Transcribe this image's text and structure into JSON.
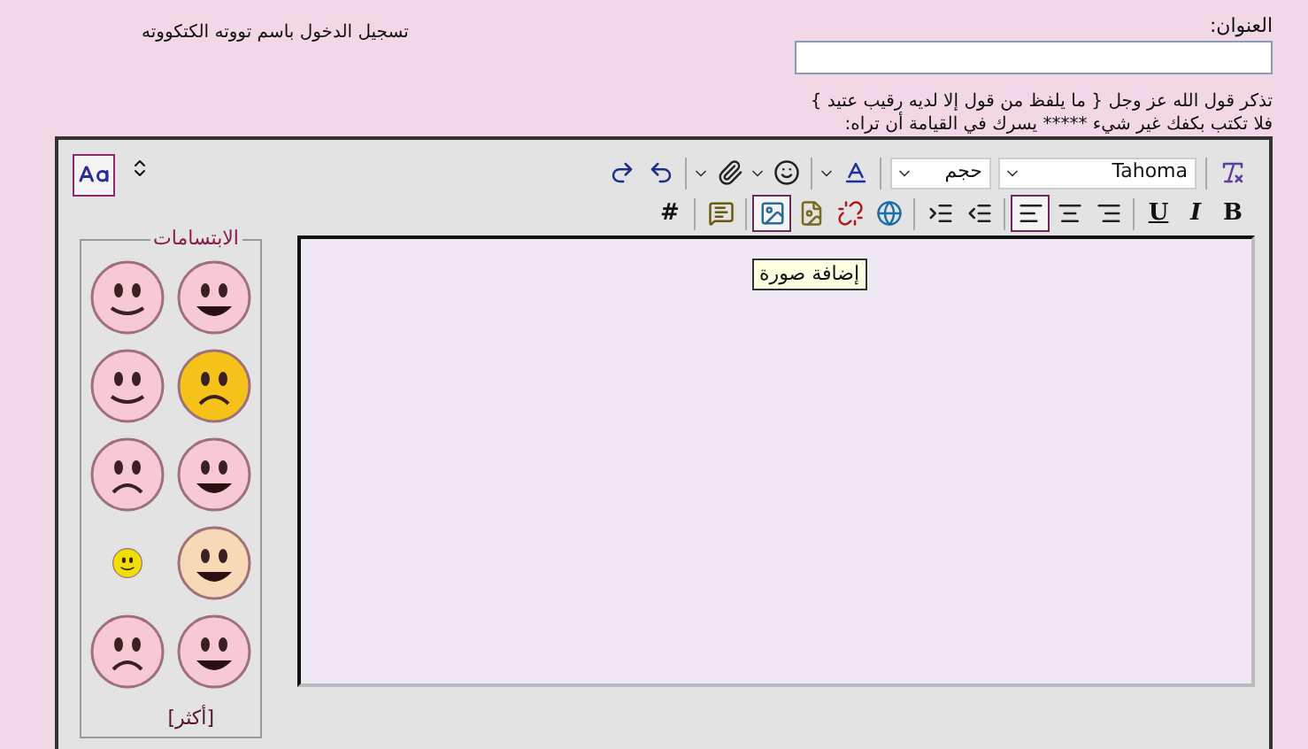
{
  "header": {
    "login_text": "تسجيل الدخول باسم تووته الكتكووته"
  },
  "title_field": {
    "label": "العنوان:"
  },
  "notes": [
    "تذكر قول الله عز وجل { ما يلفظ من قول إلا لديه رقيب عتيد }",
    "فلا تكتب بكفك غير شيء ***** يسرك في القيامة أن تراه:"
  ],
  "toolbar": {
    "rows": [
      {
        "items": [
          {
            "kind": "remove-format",
            "selected": false
          },
          {
            "kind": "separator"
          },
          {
            "kind": "font-select",
            "value": "Tahoma"
          },
          {
            "kind": "size-select",
            "value": "حجم"
          },
          {
            "kind": "separator"
          },
          {
            "kind": "text-color",
            "selected": false
          },
          {
            "kind": "separator"
          },
          {
            "kind": "emoticon",
            "selected": false
          },
          {
            "kind": "attachment",
            "selected": false
          },
          {
            "kind": "separator"
          },
          {
            "kind": "undo",
            "selected": false
          },
          {
            "kind": "redo",
            "selected": false
          }
        ]
      },
      {
        "items": [
          {
            "kind": "bold",
            "label": "B",
            "selected": false
          },
          {
            "kind": "italic",
            "label": "I",
            "selected": false
          },
          {
            "kind": "underline",
            "label": "U",
            "selected": false
          },
          {
            "kind": "separator"
          },
          {
            "kind": "align-right",
            "selected": false
          },
          {
            "kind": "align-center",
            "selected": false
          },
          {
            "kind": "align-left",
            "selected": true
          },
          {
            "kind": "separator"
          },
          {
            "kind": "outdent",
            "selected": false
          },
          {
            "kind": "indent",
            "selected": false
          },
          {
            "kind": "separator"
          },
          {
            "kind": "link",
            "selected": false
          },
          {
            "kind": "unlink",
            "selected": false
          },
          {
            "kind": "attach-image",
            "selected": false
          },
          {
            "kind": "image",
            "selected": true
          },
          {
            "kind": "separator"
          },
          {
            "kind": "comment",
            "selected": false
          },
          {
            "kind": "separator"
          },
          {
            "kind": "code",
            "label": "#",
            "selected": false
          }
        ]
      }
    ]
  },
  "side_tools": {
    "switch_mode": {
      "selected": true
    }
  },
  "editor": {
    "tooltip": "إضافة صورة"
  },
  "smilies": {
    "title": "الابتسامات",
    "more": "[أكثر]"
  }
}
